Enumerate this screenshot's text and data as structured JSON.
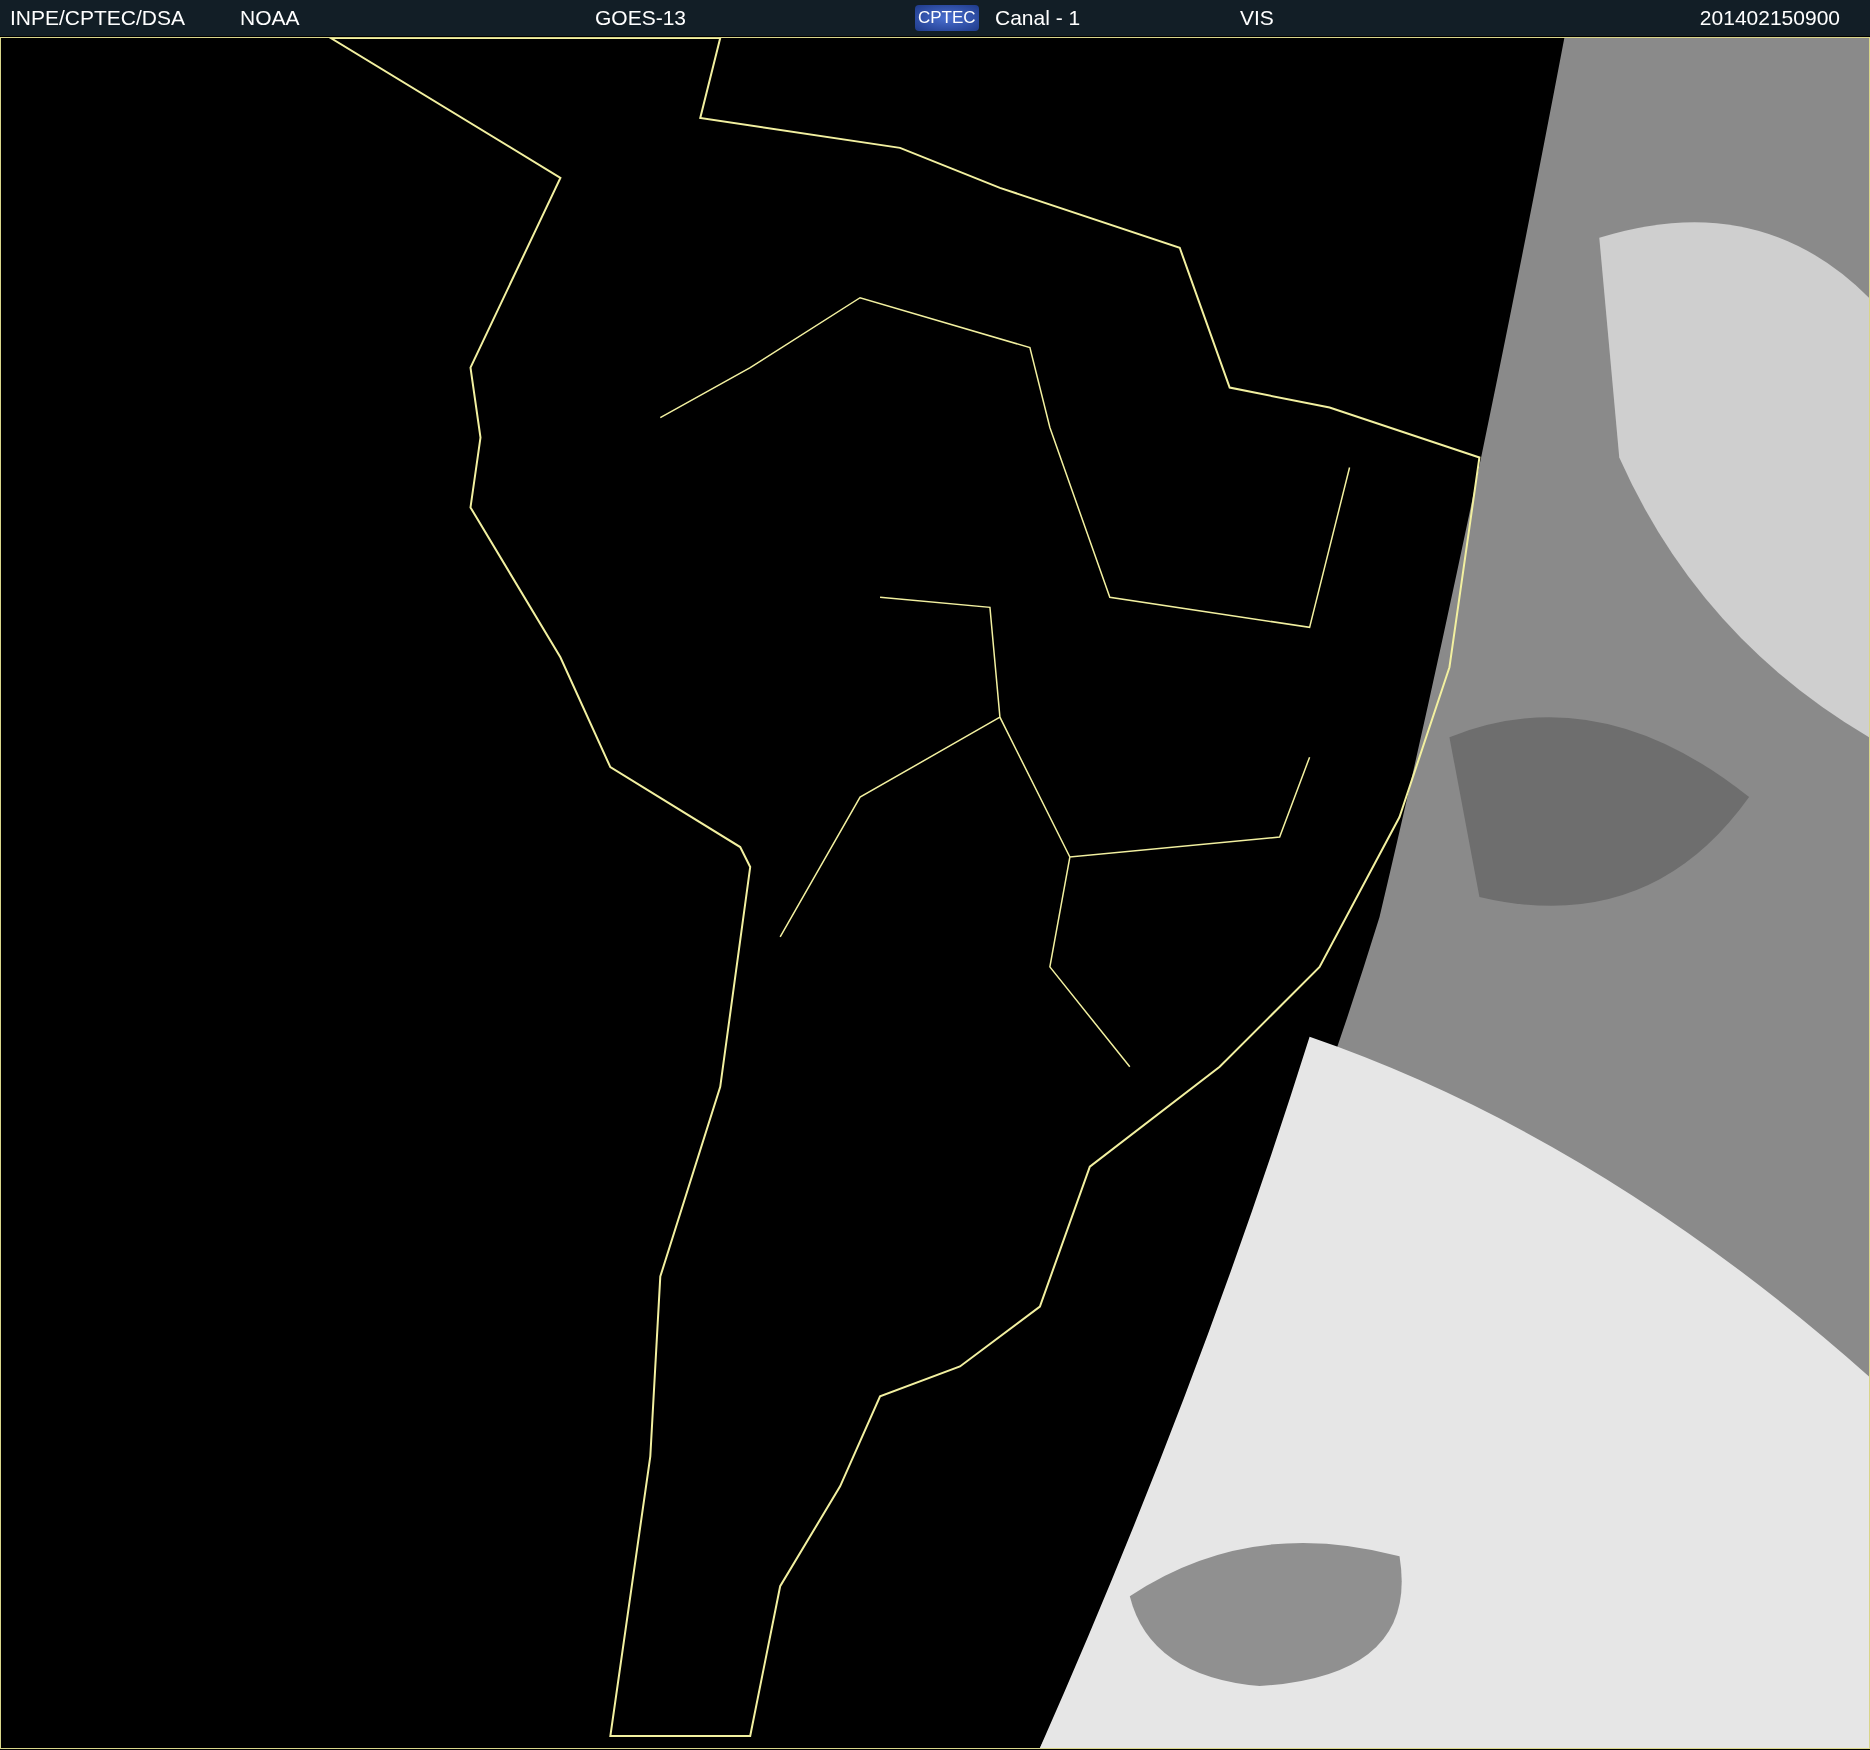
{
  "header": {
    "source": "INPE/CPTEC/DSA",
    "agency": "NOAA",
    "satellite": "GOES-13",
    "logo": "CPTEC",
    "channel": "Canal - 1",
    "band": "VIS",
    "timestamp": "201402150900"
  }
}
